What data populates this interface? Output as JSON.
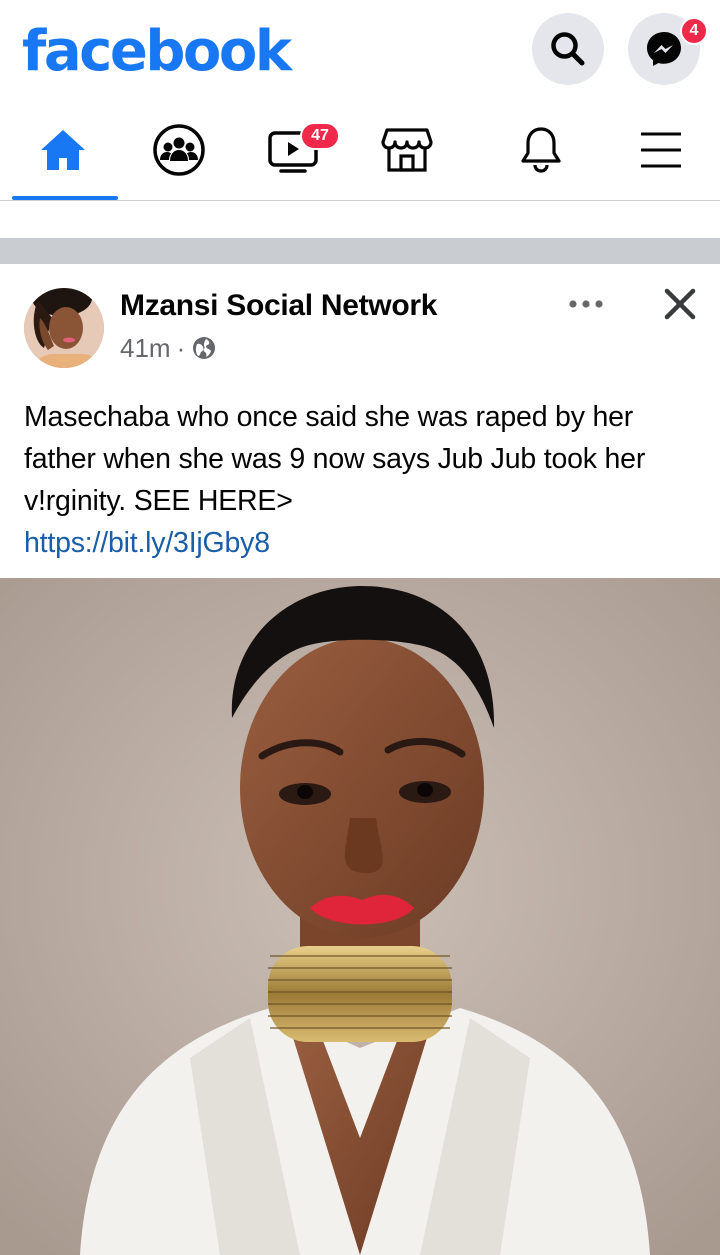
{
  "header": {
    "brand": "facebook",
    "brand_color": "#1877f2",
    "search_icon": "search-icon",
    "messenger_icon": "messenger-icon",
    "messenger_badge": "4"
  },
  "nav": {
    "tabs": [
      {
        "icon": "home-icon",
        "active": true
      },
      {
        "icon": "groups-icon",
        "active": false
      },
      {
        "icon": "watch-icon",
        "active": false,
        "badge": "47"
      },
      {
        "icon": "marketplace-icon",
        "active": false
      },
      {
        "icon": "bell-icon",
        "active": false
      },
      {
        "icon": "menu-icon",
        "active": false
      }
    ]
  },
  "post": {
    "author": "Mzansi Social Network",
    "time": "41m",
    "separator": "·",
    "audience_icon": "globe-icon",
    "text": "Masechaba who once said she was raped by her father when she was 9 now says Jub Jub took her v!rginity. SEE HERE>",
    "link": "https://bit.ly/3IjGby8",
    "link_color": "#1a5ea8"
  }
}
